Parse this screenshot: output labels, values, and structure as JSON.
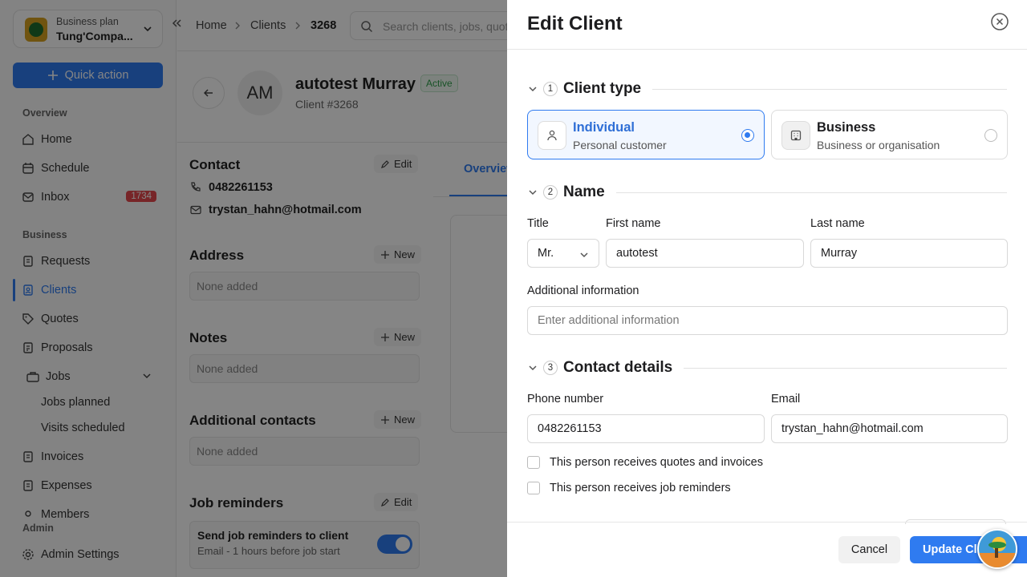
{
  "sidebar": {
    "plan": "Business plan",
    "company": "Tung'Compa...",
    "quick_action": "Quick action",
    "sections": {
      "overview": "Overview",
      "business": "Business",
      "admin": "Admin"
    },
    "items": {
      "home": "Home",
      "schedule": "Schedule",
      "inbox": "Inbox",
      "inbox_badge": "1734",
      "requests": "Requests",
      "clients": "Clients",
      "quotes": "Quotes",
      "proposals": "Proposals",
      "jobs": "Jobs",
      "jobs_planned": "Jobs planned",
      "visits_scheduled": "Visits scheduled",
      "invoices": "Invoices",
      "expenses": "Expenses",
      "members": "Members",
      "admin_settings": "Admin Settings"
    }
  },
  "topbar": {
    "breadcrumb": [
      "Home",
      "Clients",
      "3268"
    ],
    "search_placeholder": "Search clients, jobs, quotes"
  },
  "client": {
    "initials": "AM",
    "name": "autotest Murray",
    "status": "Active",
    "number": "Client #3268",
    "contact_title": "Contact",
    "edit": "Edit",
    "phone": "0482261153",
    "email": "trystan_hahn@hotmail.com",
    "address_title": "Address",
    "notes_title": "Notes",
    "additional_contacts_title": "Additional contacts",
    "new": "New",
    "none_added": "None added",
    "job_reminders_title": "Job reminders",
    "reminder_title": "Send job reminders to client",
    "reminder_desc": "Email - 1 hours before job start",
    "tab_overview": "Overview"
  },
  "drawer": {
    "title": "Edit Client",
    "sections": [
      {
        "num": "1",
        "label": "Client type"
      },
      {
        "num": "2",
        "label": "Name"
      },
      {
        "num": "3",
        "label": "Contact details"
      }
    ],
    "client_types": {
      "individual": {
        "title": "Individual",
        "desc": "Personal customer"
      },
      "business": {
        "title": "Business",
        "desc": "Business or organisation"
      }
    },
    "labels": {
      "title": "Title",
      "first_name": "First name",
      "last_name": "Last name",
      "additional_info": "Additional information",
      "phone": "Phone number",
      "email": "Email"
    },
    "values": {
      "title": "Mr.",
      "first_name": "autotest",
      "last_name": "Murray",
      "additional_info_placeholder": "Enter additional information",
      "phone": "0482261153",
      "email": "trystan_hahn@hotmail.com"
    },
    "checkboxes": {
      "quotes_invoices": "This person receives quotes and invoices",
      "job_reminders": "This person receives job reminders"
    },
    "buttons": {
      "cancel": "Cancel",
      "update": "Update Client"
    }
  },
  "colors": {
    "accent": "#2f7bf0",
    "danger": "#e5484d",
    "success": "#2e9e4a"
  }
}
